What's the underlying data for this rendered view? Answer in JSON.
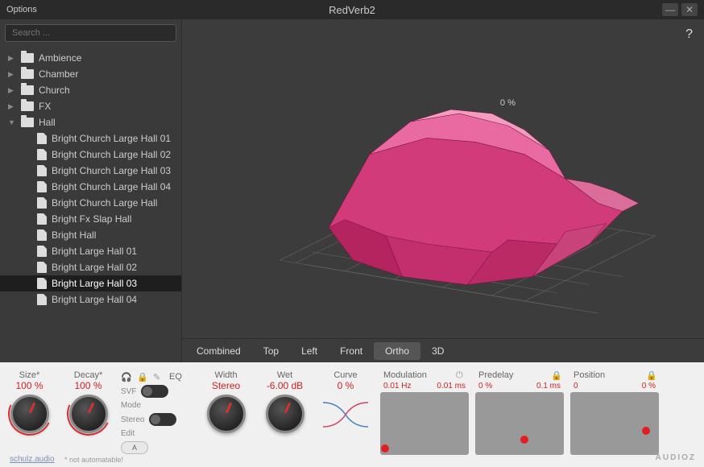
{
  "app": {
    "options": "Options",
    "title": "RedVerb2"
  },
  "search": {
    "placeholder": "Search ..."
  },
  "folders": [
    {
      "name": "Ambience",
      "open": false
    },
    {
      "name": "Chamber",
      "open": false
    },
    {
      "name": "Church",
      "open": false
    },
    {
      "name": "FX",
      "open": false
    },
    {
      "name": "Hall",
      "open": true
    }
  ],
  "files": [
    "Bright Church Large Hall 01",
    "Bright Church Large Hall 02",
    "Bright Church Large Hall 03",
    "Bright Church Large Hall 04",
    "Bright Church Large Hall",
    "Bright Fx Slap Hall",
    "Bright Hall",
    "Bright Large Hall 01",
    "Bright Large Hall 02",
    "Bright Large Hall 03",
    "Bright Large Hall 04"
  ],
  "selected_file_index": 9,
  "help_label": "?",
  "view_tabs": [
    "Combined",
    "Top",
    "Left",
    "Front",
    "Ortho",
    "3D"
  ],
  "active_view_index": 4,
  "zaxis_label": "0 %",
  "knobs": {
    "size": {
      "label": "Size*",
      "value": "100 %"
    },
    "decay": {
      "label": "Decay*",
      "value": "100 %"
    },
    "width": {
      "label": "Width",
      "value": "Stereo"
    },
    "wet": {
      "label": "Wet",
      "value": "-6.00 dB"
    },
    "curve": {
      "label": "Curve",
      "value": "0 %"
    }
  },
  "eq": {
    "head": "EQ",
    "svf": "SVF",
    "mode": "Mode",
    "stereo": "Stereo",
    "edit": "Edit",
    "edit_btn": "A"
  },
  "xy": {
    "modulation": {
      "label": "Modulation",
      "v1": "0.01 Hz",
      "v2": "0.01 ms",
      "dot": [
        5,
        90
      ]
    },
    "predelay": {
      "label": "Predelay",
      "v1": "0 %",
      "v2": "0.1 ms",
      "dot": [
        55,
        75
      ]
    },
    "position": {
      "label": "Position",
      "v1": "0",
      "v2": "0 %",
      "dot": [
        85,
        62
      ]
    }
  },
  "footer": {
    "link": "schulz.audio",
    "note": "* not automatable!"
  },
  "watermark": "AUDIOZ"
}
